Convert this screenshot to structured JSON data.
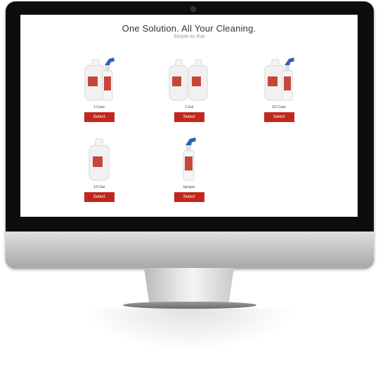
{
  "page": {
    "headline": "One Solution. All Your Cleaning.",
    "subheadline": "Simple as that"
  },
  "products": [
    {
      "label": "1-Case",
      "button": "Select",
      "icon": "jug-and-spray-bottle-icon"
    },
    {
      "label": "1-Gal",
      "button": "Select",
      "icon": "two-gallon-jugs-icon"
    },
    {
      "label": "1/2-Case",
      "button": "Select",
      "icon": "jug-and-spray-bottle-icon"
    },
    {
      "label": "1/2-Gal",
      "button": "Select",
      "icon": "gallon-jug-icon"
    },
    {
      "label": "Sprayer",
      "button": "Select",
      "icon": "spray-bottle-icon"
    }
  ],
  "colors": {
    "button_bg": "#c0281c",
    "button_text": "#ffffff",
    "sprayer_trigger": "#2f5fb8",
    "label_red": "#c0281c"
  }
}
